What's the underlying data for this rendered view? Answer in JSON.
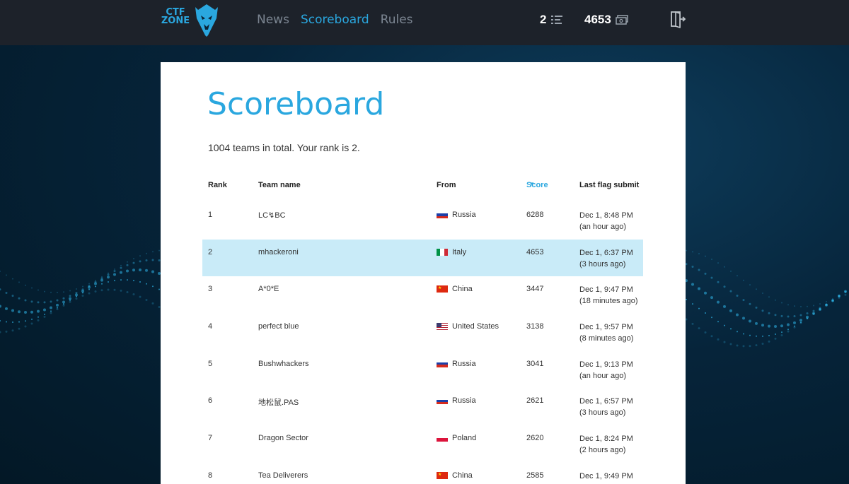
{
  "header": {
    "logo_line1": "CTF",
    "logo_line2": "ZONE",
    "nav": [
      {
        "label": "News",
        "active": false
      },
      {
        "label": "Scoreboard",
        "active": true
      },
      {
        "label": "Rules",
        "active": false
      }
    ],
    "rank_value": "2",
    "score_value": "4653"
  },
  "page": {
    "title": "Scoreboard",
    "summary": "1004 teams in total. Your rank is 2."
  },
  "table": {
    "headers": {
      "rank": "Rank",
      "team": "Team name",
      "from": "From",
      "score": "Score",
      "last": "Last flag submit"
    },
    "sort_column": "score",
    "rows": [
      {
        "rank": "1",
        "team": "LC↯BC",
        "country": "Russia",
        "flag": "ru",
        "score": "6288",
        "last": "Dec 1, 8:48 PM",
        "ago": "(an hour ago)",
        "mine": false
      },
      {
        "rank": "2",
        "team": "mhackeroni",
        "country": "Italy",
        "flag": "it",
        "score": "4653",
        "last": "Dec 1, 6:37 PM",
        "ago": "(3 hours ago)",
        "mine": true
      },
      {
        "rank": "3",
        "team": "A*0*E",
        "country": "China",
        "flag": "cn",
        "score": "3447",
        "last": "Dec 1, 9:47 PM",
        "ago": "(18 minutes ago)",
        "mine": false
      },
      {
        "rank": "4",
        "team": "perfect blue",
        "country": "United States",
        "flag": "us",
        "score": "3138",
        "last": "Dec 1, 9:57 PM",
        "ago": "(8 minutes ago)",
        "mine": false
      },
      {
        "rank": "5",
        "team": "Bushwhackers",
        "country": "Russia",
        "flag": "ru",
        "score": "3041",
        "last": "Dec 1, 9:13 PM",
        "ago": "(an hour ago)",
        "mine": false
      },
      {
        "rank": "6",
        "team": "地松鼠.PAS",
        "country": "Russia",
        "flag": "ru",
        "score": "2621",
        "last": "Dec 1, 6:57 PM",
        "ago": "(3 hours ago)",
        "mine": false
      },
      {
        "rank": "7",
        "team": "Dragon Sector",
        "country": "Poland",
        "flag": "pl",
        "score": "2620",
        "last": "Dec 1, 8:24 PM",
        "ago": "(2 hours ago)",
        "mine": false
      },
      {
        "rank": "8",
        "team": "Tea Deliverers",
        "country": "China",
        "flag": "cn",
        "score": "2585",
        "last": "Dec 1, 9:49 PM",
        "ago": "",
        "mine": false
      }
    ]
  },
  "colors": {
    "accent": "#2aa7df",
    "topbar": "#1d222a",
    "highlight_row": "#c9ebf8"
  }
}
